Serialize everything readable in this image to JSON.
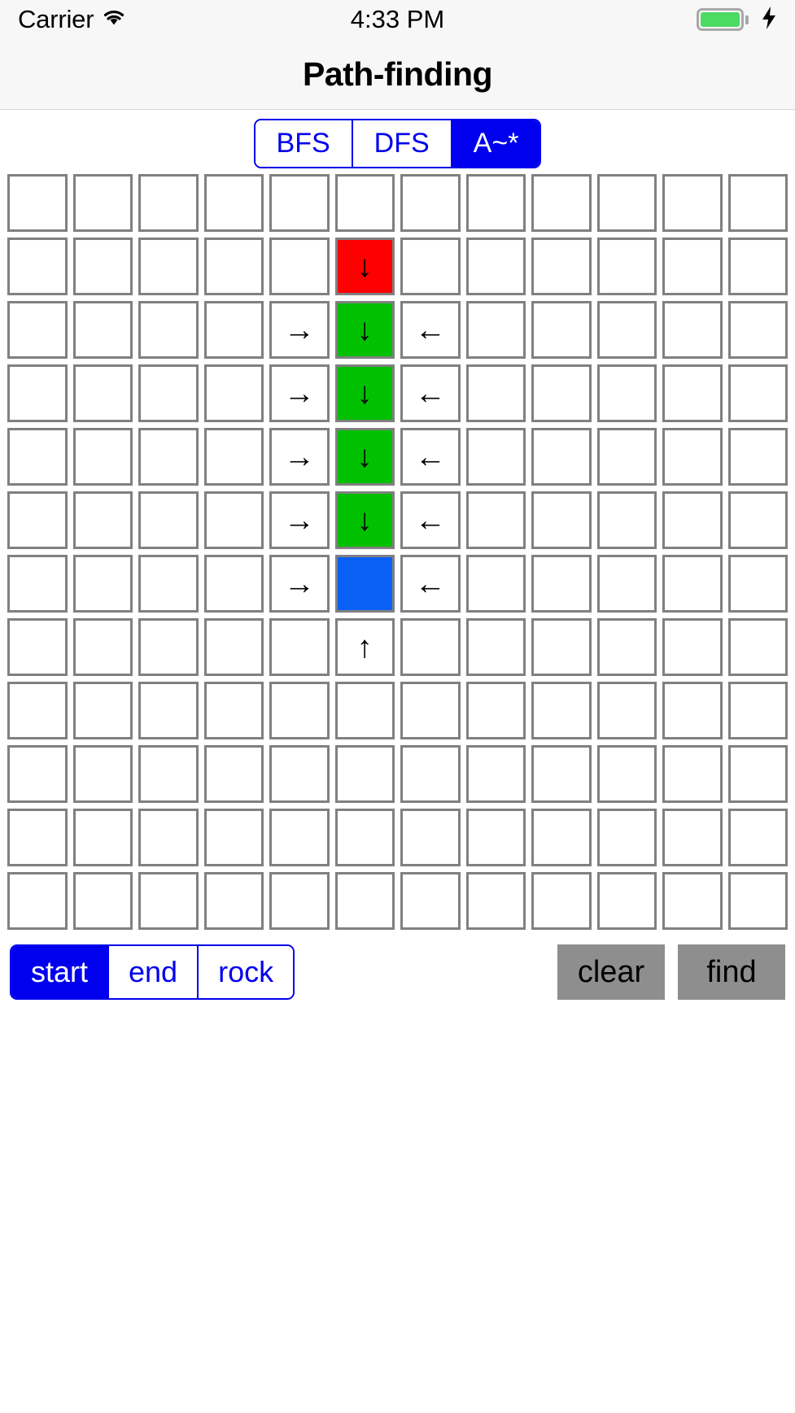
{
  "status_bar": {
    "carrier": "Carrier",
    "wifi_icon": "wifi-icon",
    "time": "4:33 PM",
    "battery_icon": "battery-icon",
    "charging_icon": "lightning-bolt-icon",
    "battery_color": "#4cd964"
  },
  "nav": {
    "title": "Path-finding"
  },
  "algorithm_control": {
    "options": [
      {
        "label": "BFS",
        "selected": false
      },
      {
        "label": "DFS",
        "selected": false
      },
      {
        "label": "A~*",
        "selected": true
      }
    ],
    "selected_value": "A~*",
    "accent_color": "#0000ee"
  },
  "grid": {
    "rows": 12,
    "cols": 12,
    "legend": {
      "start_color": "#ff0000",
      "path_color": "#00c000",
      "end_color": "#0a5ff5",
      "empty_color": "#ffffff",
      "border_color": "#808080"
    },
    "cells": [
      [
        {
          "t": "",
          "s": ""
        },
        {
          "t": "",
          "s": ""
        },
        {
          "t": "",
          "s": ""
        },
        {
          "t": "",
          "s": ""
        },
        {
          "t": "",
          "s": ""
        },
        {
          "t": "",
          "s": ""
        },
        {
          "t": "",
          "s": ""
        },
        {
          "t": "",
          "s": ""
        },
        {
          "t": "",
          "s": ""
        },
        {
          "t": "",
          "s": ""
        },
        {
          "t": "",
          "s": ""
        },
        {
          "t": "",
          "s": ""
        }
      ],
      [
        {
          "t": "",
          "s": ""
        },
        {
          "t": "",
          "s": ""
        },
        {
          "t": "",
          "s": ""
        },
        {
          "t": "",
          "s": ""
        },
        {
          "t": "",
          "s": ""
        },
        {
          "t": "↓",
          "s": "start"
        },
        {
          "t": "",
          "s": ""
        },
        {
          "t": "",
          "s": ""
        },
        {
          "t": "",
          "s": ""
        },
        {
          "t": "",
          "s": ""
        },
        {
          "t": "",
          "s": ""
        },
        {
          "t": "",
          "s": ""
        }
      ],
      [
        {
          "t": "",
          "s": ""
        },
        {
          "t": "",
          "s": ""
        },
        {
          "t": "",
          "s": ""
        },
        {
          "t": "",
          "s": ""
        },
        {
          "t": "→",
          "s": ""
        },
        {
          "t": "↓",
          "s": "path"
        },
        {
          "t": "←",
          "s": ""
        },
        {
          "t": "",
          "s": ""
        },
        {
          "t": "",
          "s": ""
        },
        {
          "t": "",
          "s": ""
        },
        {
          "t": "",
          "s": ""
        },
        {
          "t": "",
          "s": ""
        }
      ],
      [
        {
          "t": "",
          "s": ""
        },
        {
          "t": "",
          "s": ""
        },
        {
          "t": "",
          "s": ""
        },
        {
          "t": "",
          "s": ""
        },
        {
          "t": "→",
          "s": ""
        },
        {
          "t": "↓",
          "s": "path"
        },
        {
          "t": "←",
          "s": ""
        },
        {
          "t": "",
          "s": ""
        },
        {
          "t": "",
          "s": ""
        },
        {
          "t": "",
          "s": ""
        },
        {
          "t": "",
          "s": ""
        },
        {
          "t": "",
          "s": ""
        }
      ],
      [
        {
          "t": "",
          "s": ""
        },
        {
          "t": "",
          "s": ""
        },
        {
          "t": "",
          "s": ""
        },
        {
          "t": "",
          "s": ""
        },
        {
          "t": "→",
          "s": ""
        },
        {
          "t": "↓",
          "s": "path"
        },
        {
          "t": "←",
          "s": ""
        },
        {
          "t": "",
          "s": ""
        },
        {
          "t": "",
          "s": ""
        },
        {
          "t": "",
          "s": ""
        },
        {
          "t": "",
          "s": ""
        },
        {
          "t": "",
          "s": ""
        }
      ],
      [
        {
          "t": "",
          "s": ""
        },
        {
          "t": "",
          "s": ""
        },
        {
          "t": "",
          "s": ""
        },
        {
          "t": "",
          "s": ""
        },
        {
          "t": "→",
          "s": ""
        },
        {
          "t": "↓",
          "s": "path"
        },
        {
          "t": "←",
          "s": ""
        },
        {
          "t": "",
          "s": ""
        },
        {
          "t": "",
          "s": ""
        },
        {
          "t": "",
          "s": ""
        },
        {
          "t": "",
          "s": ""
        },
        {
          "t": "",
          "s": ""
        }
      ],
      [
        {
          "t": "",
          "s": ""
        },
        {
          "t": "",
          "s": ""
        },
        {
          "t": "",
          "s": ""
        },
        {
          "t": "",
          "s": ""
        },
        {
          "t": "→",
          "s": ""
        },
        {
          "t": "",
          "s": "end"
        },
        {
          "t": "←",
          "s": ""
        },
        {
          "t": "",
          "s": ""
        },
        {
          "t": "",
          "s": ""
        },
        {
          "t": "",
          "s": ""
        },
        {
          "t": "",
          "s": ""
        },
        {
          "t": "",
          "s": ""
        }
      ],
      [
        {
          "t": "",
          "s": ""
        },
        {
          "t": "",
          "s": ""
        },
        {
          "t": "",
          "s": ""
        },
        {
          "t": "",
          "s": ""
        },
        {
          "t": "",
          "s": ""
        },
        {
          "t": "↑",
          "s": ""
        },
        {
          "t": "",
          "s": ""
        },
        {
          "t": "",
          "s": ""
        },
        {
          "t": "",
          "s": ""
        },
        {
          "t": "",
          "s": ""
        },
        {
          "t": "",
          "s": ""
        },
        {
          "t": "",
          "s": ""
        }
      ],
      [
        {
          "t": "",
          "s": ""
        },
        {
          "t": "",
          "s": ""
        },
        {
          "t": "",
          "s": ""
        },
        {
          "t": "",
          "s": ""
        },
        {
          "t": "",
          "s": ""
        },
        {
          "t": "",
          "s": ""
        },
        {
          "t": "",
          "s": ""
        },
        {
          "t": "",
          "s": ""
        },
        {
          "t": "",
          "s": ""
        },
        {
          "t": "",
          "s": ""
        },
        {
          "t": "",
          "s": ""
        },
        {
          "t": "",
          "s": ""
        }
      ],
      [
        {
          "t": "",
          "s": ""
        },
        {
          "t": "",
          "s": ""
        },
        {
          "t": "",
          "s": ""
        },
        {
          "t": "",
          "s": ""
        },
        {
          "t": "",
          "s": ""
        },
        {
          "t": "",
          "s": ""
        },
        {
          "t": "",
          "s": ""
        },
        {
          "t": "",
          "s": ""
        },
        {
          "t": "",
          "s": ""
        },
        {
          "t": "",
          "s": ""
        },
        {
          "t": "",
          "s": ""
        },
        {
          "t": "",
          "s": ""
        }
      ],
      [
        {
          "t": "",
          "s": ""
        },
        {
          "t": "",
          "s": ""
        },
        {
          "t": "",
          "s": ""
        },
        {
          "t": "",
          "s": ""
        },
        {
          "t": "",
          "s": ""
        },
        {
          "t": "",
          "s": ""
        },
        {
          "t": "",
          "s": ""
        },
        {
          "t": "",
          "s": ""
        },
        {
          "t": "",
          "s": ""
        },
        {
          "t": "",
          "s": ""
        },
        {
          "t": "",
          "s": ""
        },
        {
          "t": "",
          "s": ""
        }
      ],
      [
        {
          "t": "",
          "s": ""
        },
        {
          "t": "",
          "s": ""
        },
        {
          "t": "",
          "s": ""
        },
        {
          "t": "",
          "s": ""
        },
        {
          "t": "",
          "s": ""
        },
        {
          "t": "",
          "s": ""
        },
        {
          "t": "",
          "s": ""
        },
        {
          "t": "",
          "s": ""
        },
        {
          "t": "",
          "s": ""
        },
        {
          "t": "",
          "s": ""
        },
        {
          "t": "",
          "s": ""
        },
        {
          "t": "",
          "s": ""
        }
      ]
    ]
  },
  "mode_control": {
    "options": [
      {
        "label": "start",
        "selected": true
      },
      {
        "label": "end",
        "selected": false
      },
      {
        "label": "rock",
        "selected": false
      }
    ],
    "selected_value": "start",
    "accent_color": "#0000ee"
  },
  "actions": {
    "buttons": [
      {
        "label": "clear"
      },
      {
        "label": "find"
      }
    ],
    "background_color": "#8e8e8e"
  }
}
